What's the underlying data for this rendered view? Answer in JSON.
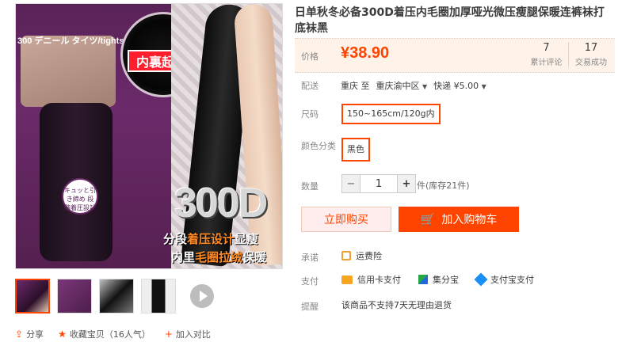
{
  "gallery": {
    "main_image": {
      "pack_label": "300 デニール タイツ/tights",
      "inner_badge": "内裏起毛",
      "round_badge": "キュッと引き締め 段階着圧設計",
      "big_text": "300D",
      "slogan_line1_a": "分段",
      "slogan_line1_b": "着压设计",
      "slogan_line1_c": "显瘦",
      "slogan_line2_a": "内里",
      "slogan_line2_b": "毛圈拉绒",
      "slogan_line2_c": "保暖"
    },
    "thumbnails_count": 4
  },
  "share": {
    "share_label": "分享",
    "favorite_label": "收藏宝贝（16人气）",
    "compare_label": "加入对比"
  },
  "product": {
    "title": "日单秋冬必备300D着压内毛圈加厚哑光微压瘦腿保暖连裤袜打底袜黑",
    "price_label": "价格",
    "currency": "¥",
    "price": "38.90",
    "stats": [
      {
        "num": "7",
        "label": "累计评论"
      },
      {
        "num": "17",
        "label": "交易成功"
      }
    ]
  },
  "shipping": {
    "label": "配送",
    "from": "重庆 至",
    "to": "重庆渝中区",
    "method": "快递 ¥5.00"
  },
  "options": {
    "size_label": "尺码",
    "size_value": "150~165cm/120g内",
    "color_label": "颜色分类",
    "color_value": "黑色"
  },
  "quantity": {
    "label": "数量",
    "minus": "−",
    "value": "1",
    "plus": "+",
    "note": "件(库存21件)"
  },
  "actions": {
    "buy_now": "立即购买",
    "add_to_cart": "加入购物车"
  },
  "promise": {
    "label": "承诺",
    "value": "运费险"
  },
  "payment": {
    "label": "支付",
    "methods": [
      "信用卡支付",
      "集分宝",
      "支付宝支付"
    ]
  },
  "reminder": {
    "label": "提醒",
    "value": "该商品不支持7天无理由退货"
  }
}
